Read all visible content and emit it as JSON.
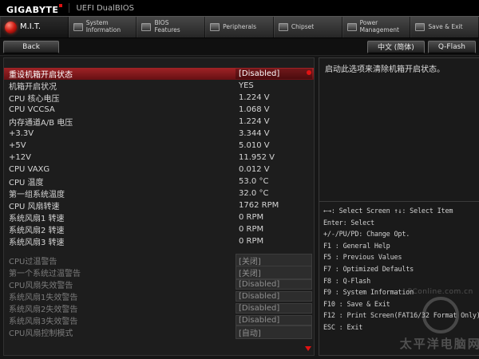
{
  "titlebar": {
    "brand": "GIGABYTE",
    "product": "UEFI DualBIOS"
  },
  "tabs": [
    {
      "label": "M.I.T."
    },
    {
      "label": "System Information"
    },
    {
      "label": "BIOS Features"
    },
    {
      "label": "Peripherals"
    },
    {
      "label": "Chipset"
    },
    {
      "label": "Power Management"
    },
    {
      "label": "Save & Exit"
    }
  ],
  "toolbar": {
    "back_label": "Back",
    "language_label": "中文 (简体)",
    "qflash_label": "Q-Flash"
  },
  "items": [
    {
      "label": "重设机箱开启状态",
      "value": "[Disabled]",
      "state": "selected"
    },
    {
      "label": "机箱开启状况",
      "value": "YES",
      "state": "readout"
    },
    {
      "label": "CPU 核心电压",
      "value": "1.224 V",
      "state": "readout"
    },
    {
      "label": "CPU VCCSA",
      "value": "1.068 V",
      "state": "readout"
    },
    {
      "label": "内存通道A/B 电压",
      "value": "1.224 V",
      "state": "readout"
    },
    {
      "label": "+3.3V",
      "value": "3.344 V",
      "state": "readout"
    },
    {
      "label": "+5V",
      "value": "5.010 V",
      "state": "readout"
    },
    {
      "label": "+12V",
      "value": "11.952 V",
      "state": "readout"
    },
    {
      "label": "CPU VAXG",
      "value": "0.012 V",
      "state": "readout"
    },
    {
      "label": "CPU 温度",
      "value": "53.0 °C",
      "state": "readout"
    },
    {
      "label": "第一组系统温度",
      "value": "32.0 °C",
      "state": "readout"
    },
    {
      "label": "CPU 风扇转速",
      "value": "1762 RPM",
      "state": "readout"
    },
    {
      "label": "系统风扇1 转速",
      "value": "0 RPM",
      "state": "readout"
    },
    {
      "label": "系统风扇2 转速",
      "value": "0 RPM",
      "state": "readout"
    },
    {
      "label": "系统风扇3 转速",
      "value": "0 RPM",
      "state": "readout"
    },
    {
      "label": "CPU过温警告",
      "value": "[关闭]",
      "state": "dim"
    },
    {
      "label": "第一个系统过温警告",
      "value": "[关闭]",
      "state": "dim"
    },
    {
      "label": "CPU风扇失效警告",
      "value": "[Disabled]",
      "state": "dim"
    },
    {
      "label": "系统风扇1失效警告",
      "value": "[Disabled]",
      "state": "dim"
    },
    {
      "label": "系统风扇2失效警告",
      "value": "[Disabled]",
      "state": "dim"
    },
    {
      "label": "系统风扇3失效警告",
      "value": "[Disabled]",
      "state": "dim"
    },
    {
      "label": "CPU风扇控制模式",
      "value": "[自动]",
      "state": "dim"
    }
  ],
  "help": {
    "description": "启动此选项来清除机箱开启状态。",
    "keys": [
      "←→: Select Screen  ↑↓: Select Item",
      "Enter: Select",
      "+/-/PU/PD: Change Opt.",
      "F1 : General Help",
      "F5 : Previous Values",
      "F7 : Optimized Defaults",
      "F8 : Q-Flash",
      "F9 : System Information",
      "F10 : Save & Exit",
      "F12 : Print Screen(FAT16/32 Format Only)",
      "ESC : Exit"
    ]
  },
  "icons": {
    "mit_tab": "red-orb-icon",
    "other_tabs": "chip-icon",
    "scroll_up": "red-dot",
    "scroll_down": "red-triangle-down"
  },
  "colors": {
    "selected_row": "#8d191b",
    "alert_red": "#e21212",
    "panel_bg": "#1d1d1d",
    "dim_text": "#7b7b7b"
  },
  "watermark": {
    "url": "PConline.com.cn",
    "site_name": "太平洋电脑网"
  }
}
